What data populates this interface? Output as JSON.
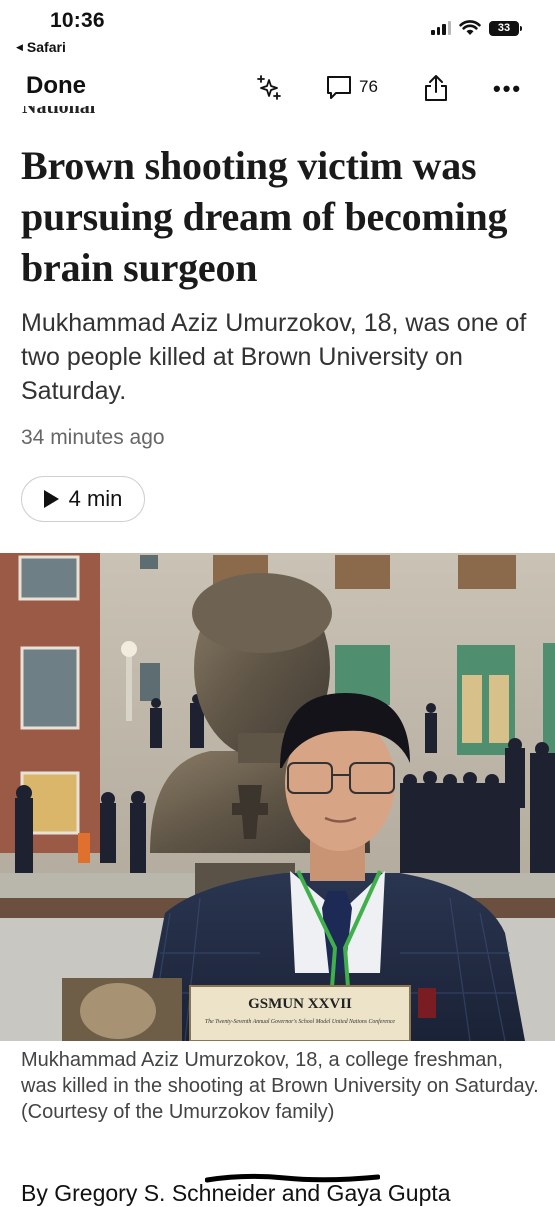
{
  "status_bar": {
    "time": "10:36",
    "back_app": "Safari",
    "battery": "33"
  },
  "toolbar": {
    "done_label": "Done",
    "comment_count": "76"
  },
  "article": {
    "section": "National",
    "headline": "Brown shooting victim was pursuing dream of becoming brain surgeon",
    "dek": "Mukhammad Aziz Umurzokov, 18, was one of two people killed at Brown University on Saturday.",
    "timestamp": "34 minutes ago",
    "audio_duration": "4 min",
    "photo": {
      "certificate_title": "GSMUN XXVII",
      "certificate_subtitle": "The Twenty-Seventh Annual Governor's School Model United Nations Conference",
      "caption": "Mukhammad Aziz Umurzokov, 18, a college freshman, was killed in the shooting at Brown University on Saturday. (Courtesy of the Umurzokov family)"
    },
    "byline": "By Gregory S. Schneider and Gaya Gupta"
  },
  "colors": {
    "headline": "#1a1a1a",
    "dek": "#333333",
    "meta": "#666666",
    "caption": "#444444"
  }
}
